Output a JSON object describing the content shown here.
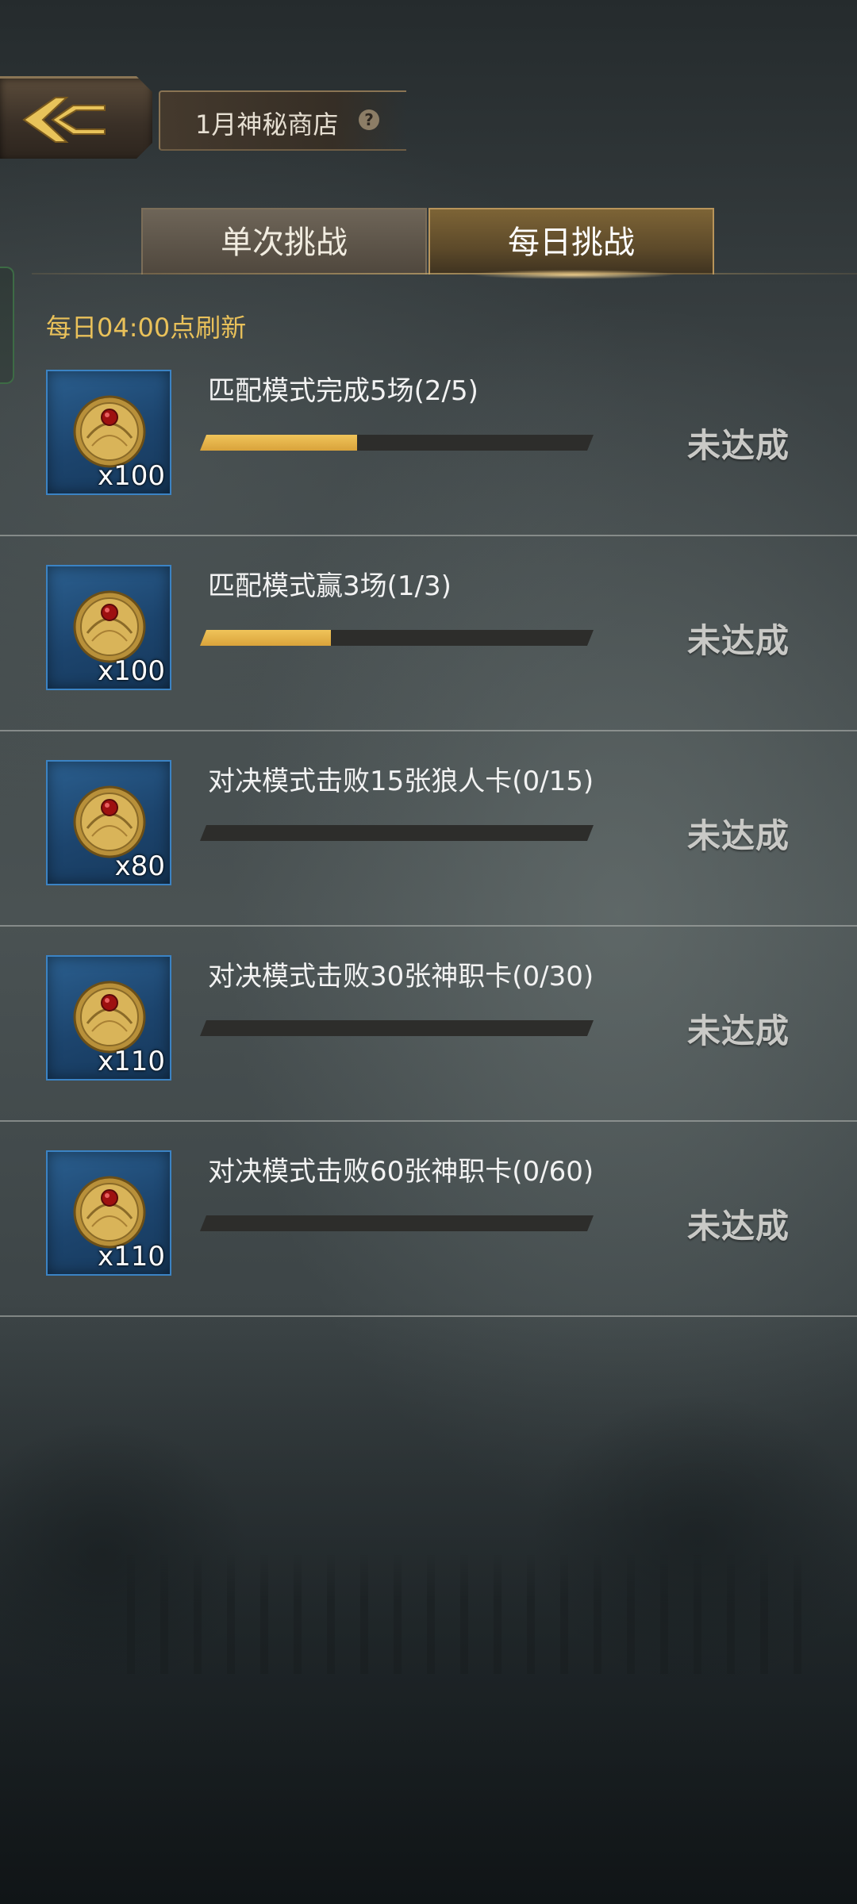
{
  "header": {
    "title": "1月神秘商店",
    "help_symbol": "?"
  },
  "tabs": [
    {
      "label": "单次挑战",
      "selected": false
    },
    {
      "label": "每日挑战",
      "selected": true
    }
  ],
  "refresh_note": "每日04:00点刷新",
  "tasks": [
    {
      "title": "匹配模式完成5场(2/5)",
      "reward": "x100",
      "progress": 0.4,
      "status": "未达成"
    },
    {
      "title": "匹配模式赢3场(1/3)",
      "reward": "x100",
      "progress": 0.333,
      "status": "未达成"
    },
    {
      "title": "对决模式击败15张狼人卡(0/15)",
      "reward": "x80",
      "progress": 0,
      "status": "未达成"
    },
    {
      "title": "对决模式击败30张神职卡(0/30)",
      "reward": "x110",
      "progress": 0,
      "status": "未达成"
    },
    {
      "title": "对决模式击败60张神职卡(0/60)",
      "reward": "x110",
      "progress": 0,
      "status": "未达成"
    }
  ],
  "colors": {
    "accent_gold": "#e9c15a",
    "reward_frame_blue": "#3b83c4",
    "status_gray": "#c9c9c6"
  },
  "icons": {
    "back": "back-arrow-icon",
    "help": "help-icon",
    "reward": "coin-icon"
  }
}
